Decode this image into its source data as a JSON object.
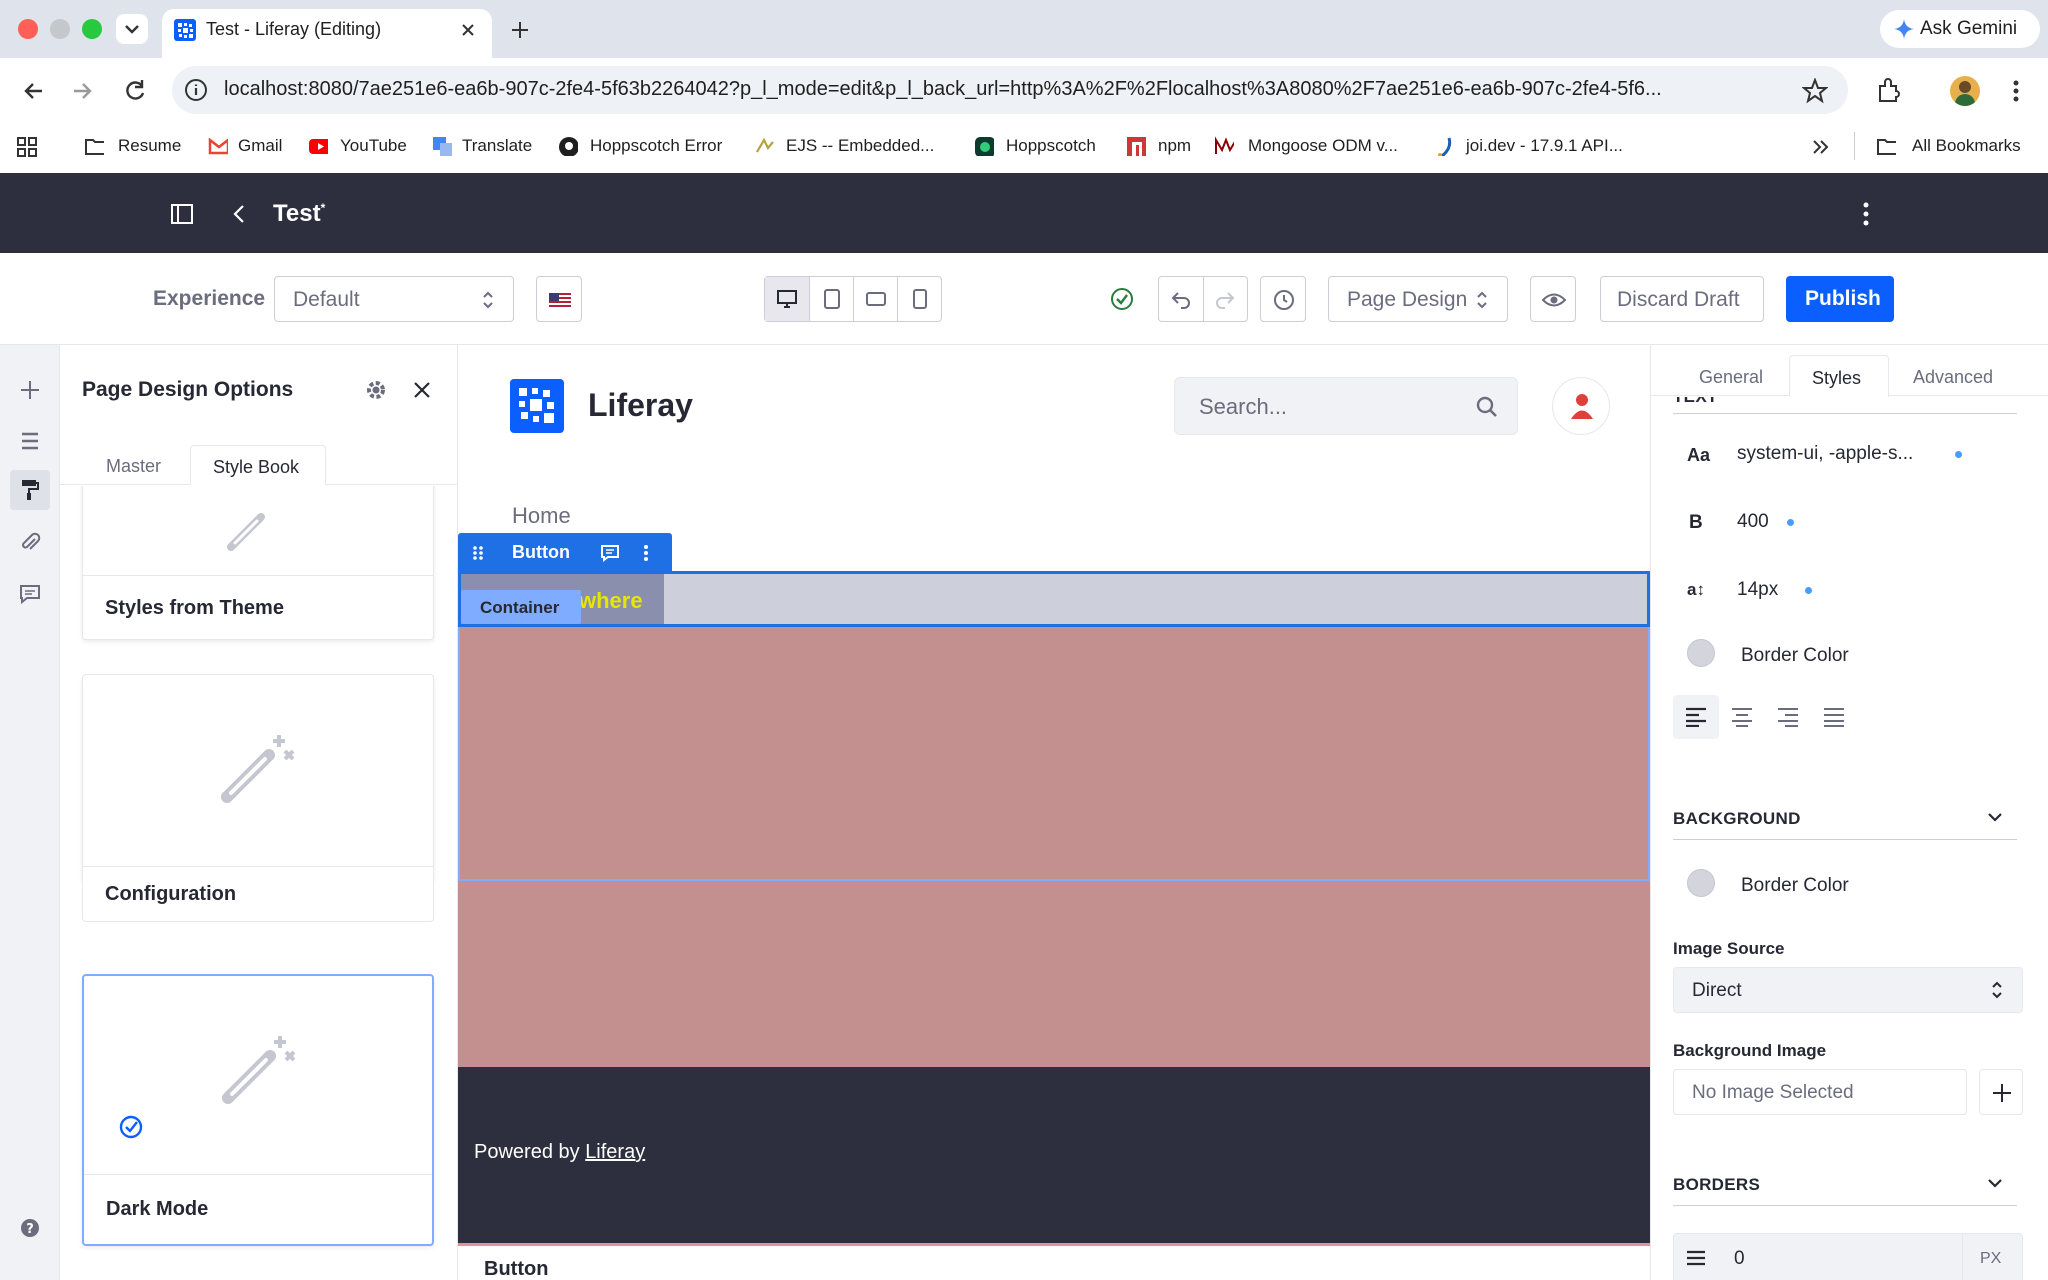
{
  "browser": {
    "tab_title": "Test - Liferay (Editing)",
    "ask_gemini": "Ask Gemini",
    "url": "localhost:8080/7ae251e6-ea6b-907c-2fe4-5f63b2264042?p_l_mode=edit&p_l_back_url=http%3A%2F%2Flocalhost%3A8080%2F7ae251e6-ea6b-907c-2fe4-5f6...",
    "bookmarks": [
      "Resume",
      "Gmail",
      "YouTube",
      "Translate",
      "Hoppscotch Error",
      "EJS -- Embedded...",
      "Hoppscotch",
      "npm",
      "Mongoose ODM v...",
      "joi.dev - 17.9.1 API..."
    ],
    "all_bookmarks": "All Bookmarks"
  },
  "header": {
    "title": "Test",
    "modified_mark": "*"
  },
  "toolbar": {
    "experience_label": "Experience",
    "experience_value": "Default",
    "page_design": "Page Design",
    "discard_draft": "Discard Draft",
    "publish": "Publish"
  },
  "sidepanel": {
    "title": "Page Design Options",
    "tabs": [
      "Master",
      "Style Book"
    ],
    "cards": [
      "Styles from Theme",
      "Configuration",
      "Dark Mode"
    ]
  },
  "canvas": {
    "brand": "Liferay",
    "search_placeholder": "Search...",
    "nav_home": "Home",
    "fragment_label": "Button",
    "container_label": "Container",
    "button_text_partial": "where",
    "footer_powered": "Powered by",
    "footer_link": "Liferay",
    "bottom_label": "Button"
  },
  "rightpanel": {
    "tabs": [
      "General",
      "Styles",
      "Advanced"
    ],
    "text_section_cut": "TEXT",
    "font_family": "system-ui, -apple-s...",
    "font_weight": "400",
    "font_size": "14px",
    "font_family_glyph": "Aa",
    "font_weight_glyph": "B",
    "font_size_glyph": "a↕",
    "border_color": "Border Color",
    "background_heading": "BACKGROUND",
    "bg_border_color": "Border Color",
    "image_source_label": "Image Source",
    "image_source_value": "Direct",
    "background_image_label": "Background Image",
    "no_image": "No Image Selected",
    "borders_heading": "BORDERS",
    "border_width": "0",
    "border_unit": "PX"
  },
  "colors": {
    "primary": "#0b5fff",
    "header_dark": "#2e2f3e",
    "canvas_rose": "#c48f8f",
    "selection_blue": "#1f6fe5",
    "button_text_yellow": "#e6e600"
  }
}
